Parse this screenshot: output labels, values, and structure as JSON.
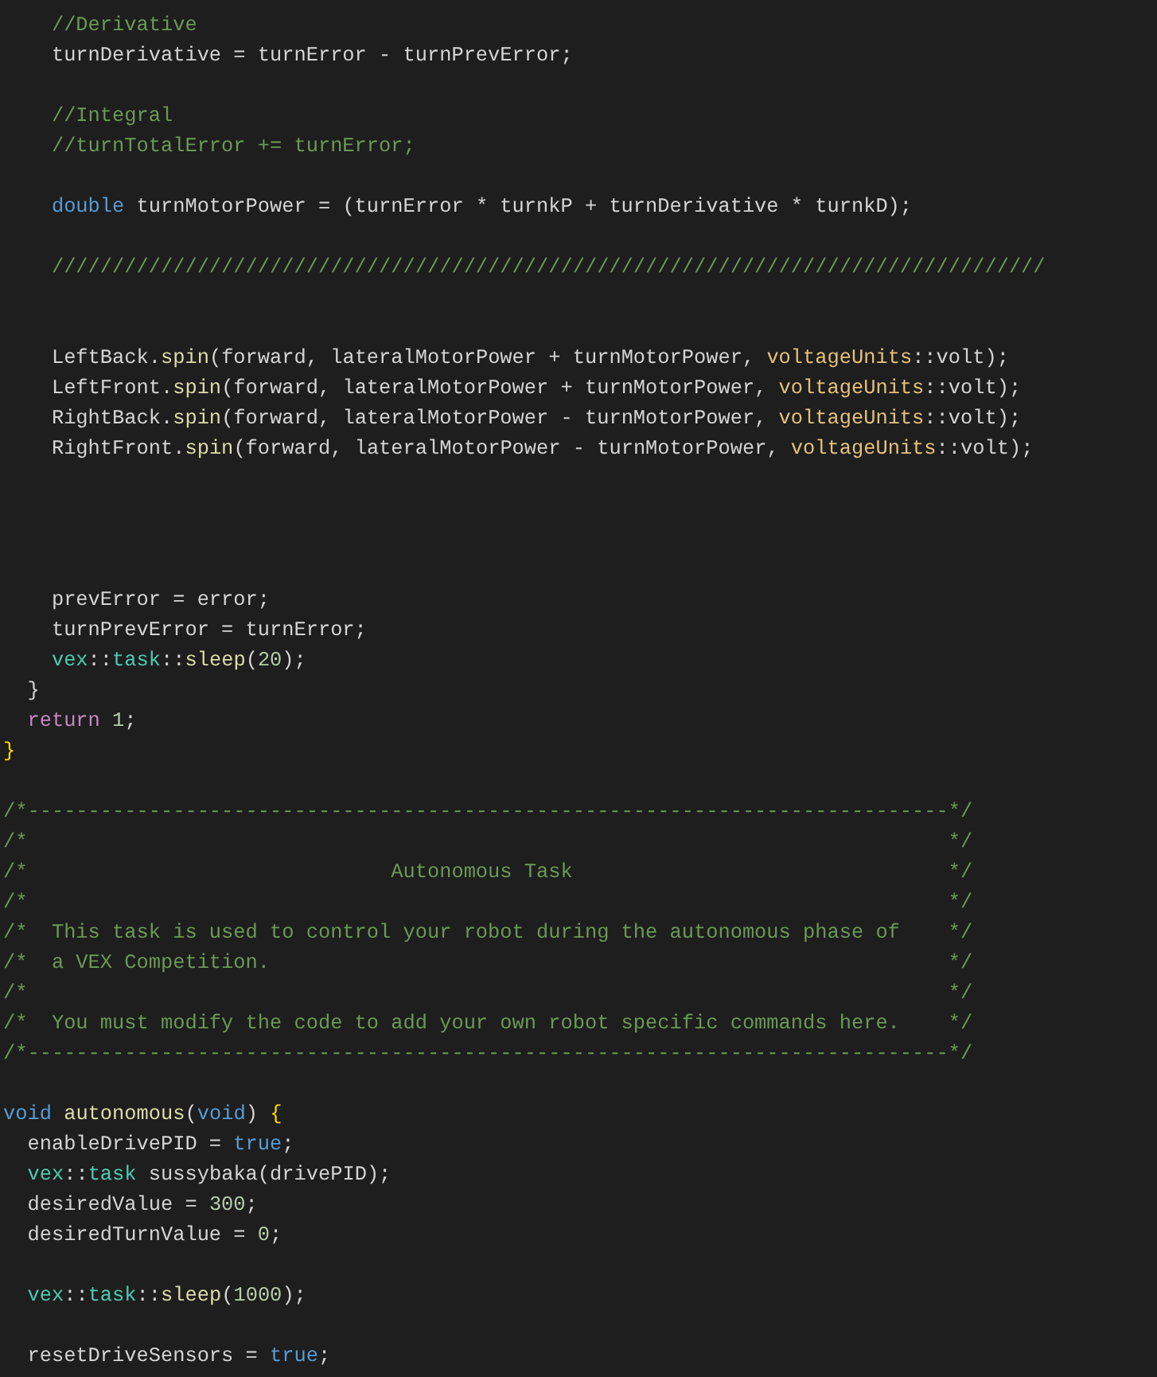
{
  "editor": {
    "lines": [
      {
        "kind": "code",
        "tokens": [
          {
            "kind": "comment",
            "text": "    //Derivative"
          }
        ]
      },
      {
        "kind": "code",
        "tokens": [
          {
            "kind": "plain",
            "text": "    turnDerivative = turnError - turnPrevError;"
          }
        ]
      },
      {
        "kind": "blank"
      },
      {
        "kind": "code",
        "tokens": [
          {
            "kind": "comment",
            "text": "    //Integral"
          }
        ]
      },
      {
        "kind": "code",
        "tokens": [
          {
            "kind": "comment",
            "text": "    //turnTotalError += turnError;"
          }
        ]
      },
      {
        "kind": "blank"
      },
      {
        "kind": "code",
        "tokens": [
          {
            "kind": "keyword",
            "text": "    double"
          },
          {
            "kind": "plain",
            "text": " turnMotorPower = (turnError * turnkP + turnDerivative * turnkD);"
          }
        ]
      },
      {
        "kind": "blank"
      },
      {
        "kind": "code",
        "tokens": [
          {
            "kind": "comment",
            "text": "    //////////////////////////////////////////////////////////////////////////////////"
          }
        ]
      },
      {
        "kind": "blank"
      },
      {
        "kind": "blank"
      },
      {
        "kind": "code",
        "tokens": [
          {
            "kind": "plain",
            "text": "    LeftBack."
          },
          {
            "kind": "function",
            "text": "spin"
          },
          {
            "kind": "plain",
            "text": "(forward, lateralMotorPower + turnMotorPower, "
          },
          {
            "kind": "enum",
            "text": "voltageUnits"
          },
          {
            "kind": "plain",
            "text": "::volt);"
          }
        ]
      },
      {
        "kind": "code",
        "tokens": [
          {
            "kind": "plain",
            "text": "    LeftFront."
          },
          {
            "kind": "function",
            "text": "spin"
          },
          {
            "kind": "plain",
            "text": "(forward, lateralMotorPower + turnMotorPower, "
          },
          {
            "kind": "enum",
            "text": "voltageUnits"
          },
          {
            "kind": "plain",
            "text": "::volt);"
          }
        ]
      },
      {
        "kind": "code",
        "tokens": [
          {
            "kind": "plain",
            "text": "    RightBack."
          },
          {
            "kind": "function",
            "text": "spin"
          },
          {
            "kind": "plain",
            "text": "(forward, lateralMotorPower - turnMotorPower, "
          },
          {
            "kind": "enum",
            "text": "voltageUnits"
          },
          {
            "kind": "plain",
            "text": "::volt);"
          }
        ]
      },
      {
        "kind": "code",
        "tokens": [
          {
            "kind": "plain",
            "text": "    RightFront."
          },
          {
            "kind": "function",
            "text": "spin"
          },
          {
            "kind": "plain",
            "text": "(forward, lateralMotorPower - turnMotorPower, "
          },
          {
            "kind": "enum",
            "text": "voltageUnits"
          },
          {
            "kind": "plain",
            "text": "::volt);"
          }
        ]
      },
      {
        "kind": "blank"
      },
      {
        "kind": "blank"
      },
      {
        "kind": "blank"
      },
      {
        "kind": "blank"
      },
      {
        "kind": "code",
        "tokens": [
          {
            "kind": "plain",
            "text": "    prevError = error;"
          }
        ]
      },
      {
        "kind": "code",
        "tokens": [
          {
            "kind": "plain",
            "text": "    turnPrevError = turnError;"
          }
        ]
      },
      {
        "kind": "code",
        "tokens": [
          {
            "kind": "type",
            "text": "    vex"
          },
          {
            "kind": "plain",
            "text": "::"
          },
          {
            "kind": "type",
            "text": "task"
          },
          {
            "kind": "plain",
            "text": "::"
          },
          {
            "kind": "function",
            "text": "sleep"
          },
          {
            "kind": "plain",
            "text": "("
          },
          {
            "kind": "number",
            "text": "20"
          },
          {
            "kind": "plain",
            "text": ");"
          }
        ]
      },
      {
        "kind": "code",
        "tokens": [
          {
            "kind": "plain",
            "text": "  }"
          }
        ]
      },
      {
        "kind": "code",
        "tokens": [
          {
            "kind": "control",
            "text": "  return"
          },
          {
            "kind": "number",
            "text": " 1"
          },
          {
            "kind": "plain",
            "text": ";"
          }
        ]
      },
      {
        "kind": "code",
        "tokens": [
          {
            "kind": "bracket",
            "text": "}"
          }
        ]
      },
      {
        "kind": "blank"
      },
      {
        "kind": "code",
        "tokens": [
          {
            "kind": "comment",
            "text": "/*----------------------------------------------------------------------------*/"
          }
        ]
      },
      {
        "kind": "code",
        "tokens": [
          {
            "kind": "comment",
            "text": "/*                                                                            */"
          }
        ]
      },
      {
        "kind": "code",
        "tokens": [
          {
            "kind": "comment",
            "text": "/*                              Autonomous Task                               */"
          }
        ]
      },
      {
        "kind": "code",
        "tokens": [
          {
            "kind": "comment",
            "text": "/*                                                                            */"
          }
        ]
      },
      {
        "kind": "code",
        "tokens": [
          {
            "kind": "comment",
            "text": "/*  This task is used to control your robot during the autonomous phase of    */"
          }
        ]
      },
      {
        "kind": "code",
        "tokens": [
          {
            "kind": "comment",
            "text": "/*  a VEX Competition.                                                        */"
          }
        ]
      },
      {
        "kind": "code",
        "tokens": [
          {
            "kind": "comment",
            "text": "/*                                                                            */"
          }
        ]
      },
      {
        "kind": "code",
        "tokens": [
          {
            "kind": "comment",
            "text": "/*  You must modify the code to add your own robot specific commands here.    */"
          }
        ]
      },
      {
        "kind": "code",
        "tokens": [
          {
            "kind": "comment",
            "text": "/*----------------------------------------------------------------------------*/"
          }
        ]
      },
      {
        "kind": "blank"
      },
      {
        "kind": "code",
        "tokens": [
          {
            "kind": "keyword",
            "text": "void"
          },
          {
            "kind": "function",
            "text": " autonomous"
          },
          {
            "kind": "plain",
            "text": "("
          },
          {
            "kind": "keyword",
            "text": "void"
          },
          {
            "kind": "plain",
            "text": ") "
          },
          {
            "kind": "bracket",
            "text": "{"
          }
        ]
      },
      {
        "kind": "code",
        "tokens": [
          {
            "kind": "plain",
            "text": "  enableDrivePID = "
          },
          {
            "kind": "keyword",
            "text": "true"
          },
          {
            "kind": "plain",
            "text": ";"
          }
        ]
      },
      {
        "kind": "code",
        "tokens": [
          {
            "kind": "type",
            "text": "  vex"
          },
          {
            "kind": "plain",
            "text": "::"
          },
          {
            "kind": "type",
            "text": "task"
          },
          {
            "kind": "plain",
            "text": " sussybaka(drivePID);"
          }
        ]
      },
      {
        "kind": "code",
        "tokens": [
          {
            "kind": "plain",
            "text": "  desiredValue = "
          },
          {
            "kind": "number",
            "text": "300"
          },
          {
            "kind": "plain",
            "text": ";"
          }
        ]
      },
      {
        "kind": "code",
        "tokens": [
          {
            "kind": "plain",
            "text": "  desiredTurnValue = "
          },
          {
            "kind": "number",
            "text": "0"
          },
          {
            "kind": "plain",
            "text": ";"
          }
        ]
      },
      {
        "kind": "blank"
      },
      {
        "kind": "code",
        "tokens": [
          {
            "kind": "type",
            "text": "  vex"
          },
          {
            "kind": "plain",
            "text": "::"
          },
          {
            "kind": "type",
            "text": "task"
          },
          {
            "kind": "plain",
            "text": "::"
          },
          {
            "kind": "function",
            "text": "sleep"
          },
          {
            "kind": "plain",
            "text": "("
          },
          {
            "kind": "number",
            "text": "1000"
          },
          {
            "kind": "plain",
            "text": ");"
          }
        ]
      },
      {
        "kind": "blank"
      },
      {
        "kind": "code",
        "tokens": [
          {
            "kind": "plain",
            "text": "  resetDriveSensors = "
          },
          {
            "kind": "keyword",
            "text": "true"
          },
          {
            "kind": "plain",
            "text": ";"
          }
        ]
      }
    ]
  }
}
